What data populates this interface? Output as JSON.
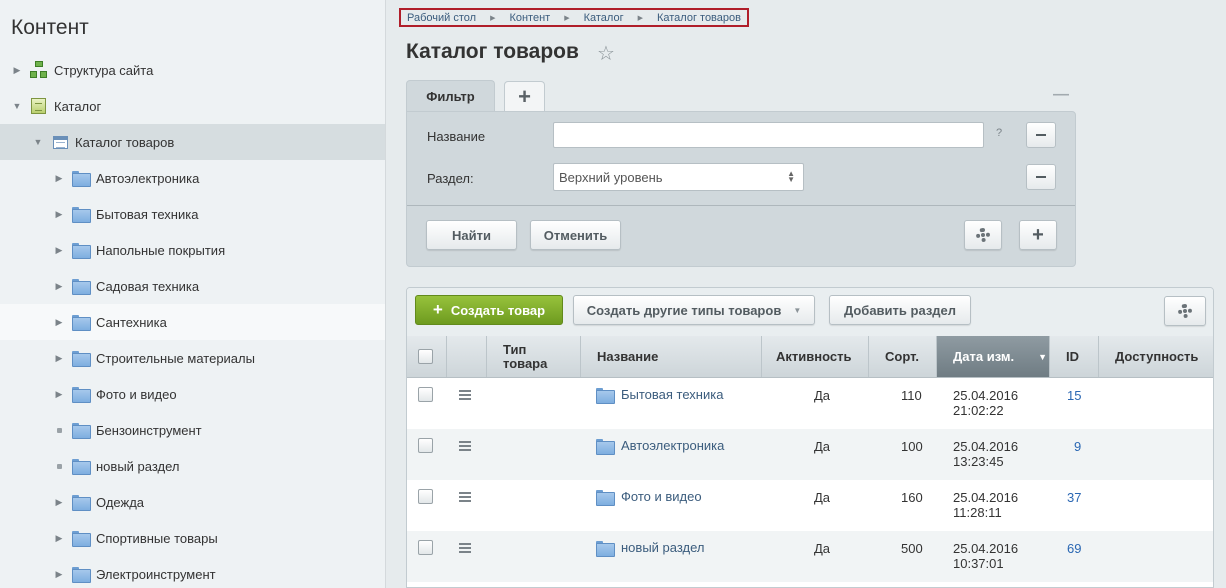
{
  "sidebar": {
    "title": "Контент",
    "items": [
      {
        "label": "Структура сайта",
        "icon": "structure-icon"
      },
      {
        "label": "Каталог",
        "icon": "catalog-icon"
      },
      {
        "label": "Каталог товаров",
        "icon": "table-icon"
      },
      {
        "label": "Автоэлектроника",
        "icon": "folder-icon"
      },
      {
        "label": "Бытовая техника",
        "icon": "folder-icon"
      },
      {
        "label": "Напольные покрытия",
        "icon": "folder-icon"
      },
      {
        "label": "Садовая техника",
        "icon": "folder-icon"
      },
      {
        "label": "Сантехника",
        "icon": "folder-icon"
      },
      {
        "label": "Строительные материалы",
        "icon": "folder-icon"
      },
      {
        "label": "Фото и видео",
        "icon": "folder-icon"
      },
      {
        "label": "Бензоинструмент",
        "icon": "folder-icon"
      },
      {
        "label": "новый раздел",
        "icon": "folder-icon"
      },
      {
        "label": "Одежда",
        "icon": "folder-icon"
      },
      {
        "label": "Спортивные товары",
        "icon": "folder-icon"
      },
      {
        "label": "Электроинструмент",
        "icon": "folder-icon"
      }
    ]
  },
  "breadcrumb": [
    "Рабочий стол",
    "Контент",
    "Каталог",
    "Каталог товаров"
  ],
  "page": {
    "title": "Каталог товаров"
  },
  "filter": {
    "tab_label": "Фильтр",
    "name_label": "Название",
    "name_value": "",
    "help": "?",
    "section_label": "Раздел:",
    "section_value": "Верхний уровень",
    "find_button": "Найти",
    "cancel_button": "Отменить"
  },
  "toolbar": {
    "create_button": "Создать товар",
    "create_other_button": "Создать другие типы товаров",
    "add_section_button": "Добавить раздел"
  },
  "table": {
    "columns": {
      "type": "Тип товара",
      "name": "Название",
      "active": "Активность",
      "sort": "Сорт.",
      "date": "Дата изм.",
      "id": "ID",
      "availability": "Доступность"
    },
    "rows": [
      {
        "name": "Бытовая техника",
        "active": "Да",
        "sort": "110",
        "date": "25.04.2016",
        "time": "21:02:22",
        "id": "15"
      },
      {
        "name": "Автоэлектроника",
        "active": "Да",
        "sort": "100",
        "date": "25.04.2016",
        "time": "13:23:45",
        "id": "9"
      },
      {
        "name": "Фото и видео",
        "active": "Да",
        "sort": "160",
        "date": "25.04.2016",
        "time": "11:28:11",
        "id": "37"
      },
      {
        "name": "новый раздел",
        "active": "Да",
        "sort": "500",
        "date": "25.04.2016",
        "time": "10:37:01",
        "id": "69"
      }
    ]
  }
}
